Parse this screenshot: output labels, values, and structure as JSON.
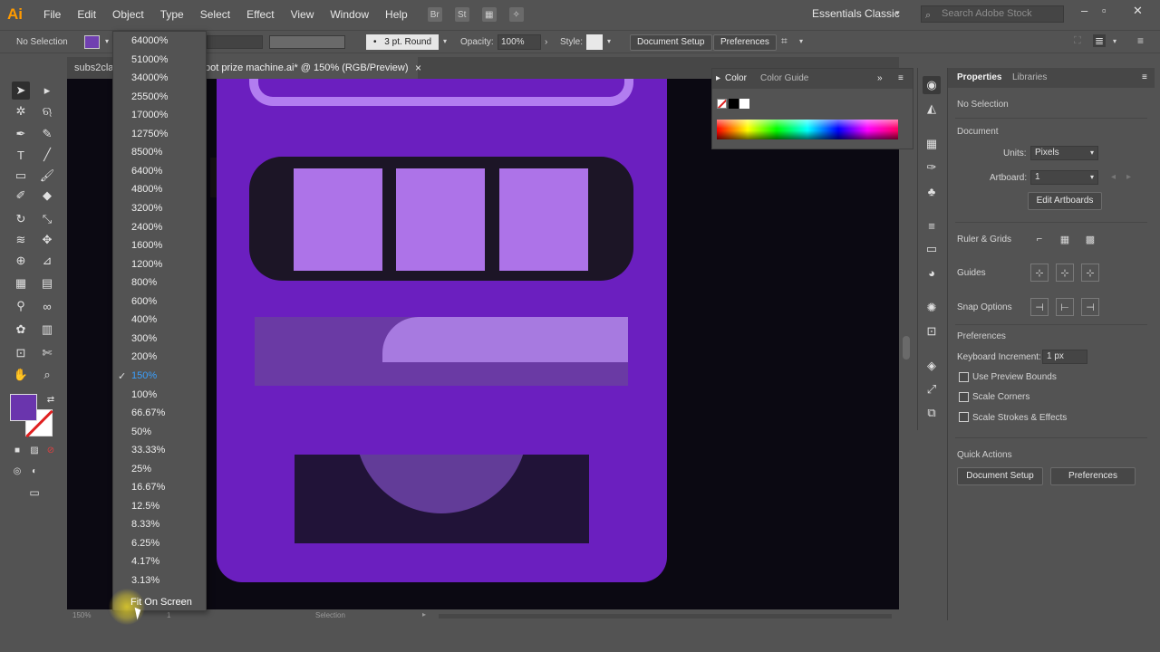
{
  "app": {
    "logo": "Ai"
  },
  "menu": [
    "File",
    "Edit",
    "Object",
    "Type",
    "Select",
    "Effect",
    "View",
    "Window",
    "Help"
  ],
  "menu_icons": {
    "bridge": "Br",
    "stock": "St"
  },
  "workspace": "Essentials Classic",
  "stock_search_placeholder": "Search Adobe Stock",
  "window_controls": [
    "–",
    "▫",
    "✕"
  ],
  "control_bar": {
    "selection": "No Selection",
    "stroke_style": "3 pt. Round",
    "opacity_label": "Opacity:",
    "opacity_value": "100%",
    "style_label": "Style:",
    "document_setup": "Document Setup",
    "preferences": "Preferences"
  },
  "doc_tabs": [
    {
      "label": "subs2cla",
      "active": false
    },
    {
      "label": "pot prize machine.ai* @ 150% (RGB/Preview)",
      "active": true
    }
  ],
  "tab_close": "×",
  "zoom_menu": {
    "items": [
      "64000%",
      "51000%",
      "34000%",
      "25500%",
      "17000%",
      "12750%",
      "8500%",
      "6400%",
      "4800%",
      "3200%",
      "2400%",
      "1600%",
      "1200%",
      "800%",
      "600%",
      "400%",
      "300%",
      "200%",
      "150%",
      "100%",
      "66.67%",
      "50%",
      "33.33%",
      "25%",
      "16.67%",
      "12.5%",
      "8.33%",
      "6.25%",
      "4.17%",
      "3.13%"
    ],
    "checked": "150%",
    "check_glyph": "✓",
    "fit": "Fit On Screen"
  },
  "status": {
    "zoom": "150%",
    "artboard": "1",
    "tool": "Selection"
  },
  "color_panel": {
    "tab_color": "Color",
    "tab_guide": "Color Guide",
    "menu_glyph": "≡",
    "collapse_glyph": "»"
  },
  "properties": {
    "tab_properties": "Properties",
    "tab_libraries": "Libraries",
    "selection": "No Selection",
    "document": "Document",
    "units_label": "Units:",
    "units_value": "Pixels",
    "artboard_label": "Artboard:",
    "artboard_value": "1",
    "edit_artboards": "Edit Artboards",
    "ruler_grids": "Ruler & Grids",
    "guides": "Guides",
    "snap_options": "Snap Options",
    "preferences_head": "Preferences",
    "keyboard_increment_label": "Keyboard Increment:",
    "keyboard_increment_value": "1 px",
    "use_preview_bounds": "Use Preview Bounds",
    "scale_corners": "Scale Corners",
    "scale_strokes": "Scale Strokes & Effects",
    "quick_actions": "Quick Actions",
    "document_setup": "Document Setup",
    "preferences_btn": "Preferences"
  },
  "colors": {
    "fill": "#6a35ad",
    "artboard": "#6b1fbf",
    "reel": "#ad73e8",
    "canvas_bg": "#0b0912",
    "checked_zoom": "#3aa0ff"
  },
  "icons": {
    "tools": [
      "selection-tool",
      "direct-selection-tool",
      "magic-wand-tool",
      "lasso-tool",
      "pen-tool",
      "curvature-tool",
      "type-tool",
      "line-segment-tool",
      "rectangle-tool",
      "paintbrush-tool",
      "shaper-tool",
      "eraser-tool",
      "rotate-tool",
      "scale-tool",
      "width-tool",
      "free-transform-tool",
      "shape-builder-tool",
      "perspective-grid-tool",
      "mesh-tool",
      "gradient-tool",
      "eyedropper-tool",
      "blend-tool",
      "symbol-sprayer-tool",
      "column-graph-tool",
      "artboard-tool",
      "slice-tool",
      "hand-tool",
      "zoom-tool"
    ],
    "strip": [
      "recolor-icon",
      "appearance-icon",
      "align-icon",
      "brushes-icon",
      "symbols-icon",
      "stroke-icon",
      "gradient-panel-icon",
      "transparency-icon",
      "asset-export-icon",
      "artboards-icon",
      "layers-icon",
      "transform-icon",
      "pathfinder-icon"
    ]
  }
}
